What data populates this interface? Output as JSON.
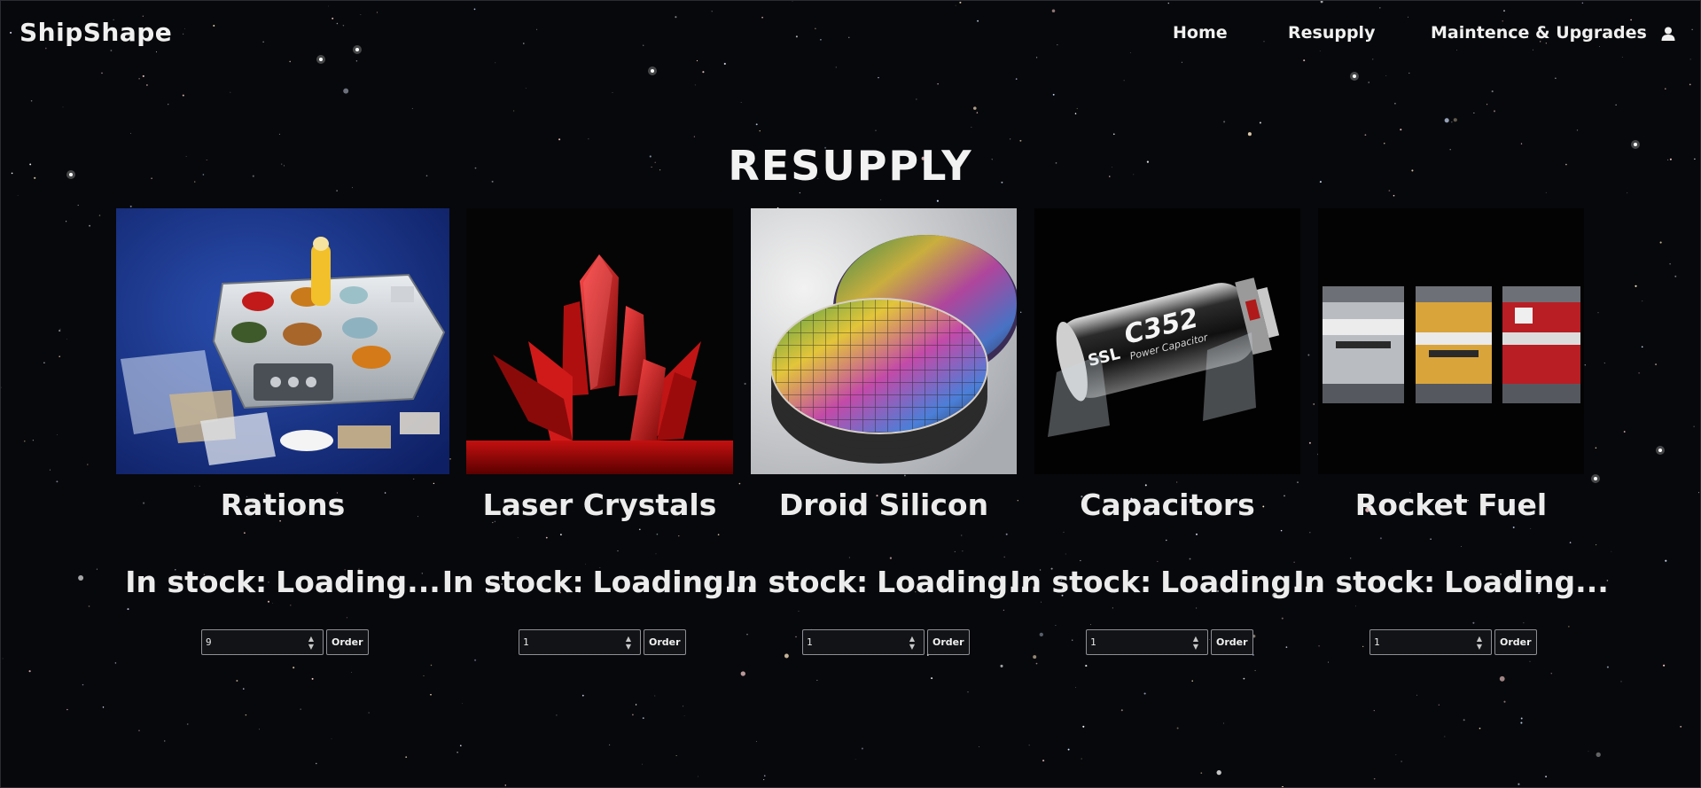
{
  "app": {
    "brand": "ShipShape"
  },
  "nav": {
    "items": [
      "Home",
      "Resupply",
      "Maintence & Upgrades"
    ],
    "user_icon": "user-icon"
  },
  "page": {
    "title": "RESUPPLY"
  },
  "products": [
    {
      "name": "Rations",
      "stock_label": "In stock:",
      "stock_value": "Loading...",
      "quantity": "9",
      "order_label": "Order"
    },
    {
      "name": "Laser Crystals",
      "stock_label": "In stock:",
      "stock_value": "Loading...",
      "quantity": "1",
      "order_label": "Order"
    },
    {
      "name": "Droid Silicon",
      "stock_label": "In stock:",
      "stock_value": "Loading...",
      "quantity": "1",
      "order_label": "Order"
    },
    {
      "name": "Capacitors",
      "stock_label": "In stock:",
      "stock_value": "Loading...",
      "quantity": "1",
      "order_label": "Order"
    },
    {
      "name": "Rocket Fuel",
      "stock_label": "In stock:",
      "stock_value": "Loading...",
      "quantity": "1",
      "order_label": "Order"
    }
  ],
  "product_images": {
    "rations": "space-food-tray-image",
    "capacitor_label": "C352",
    "capacitor_sublabel": "Power Capacitor",
    "capacitor_brand": "SSL"
  },
  "colors": {
    "background": "#07080b",
    "text": "#eaeaea",
    "control_border": "#8d8f96"
  }
}
